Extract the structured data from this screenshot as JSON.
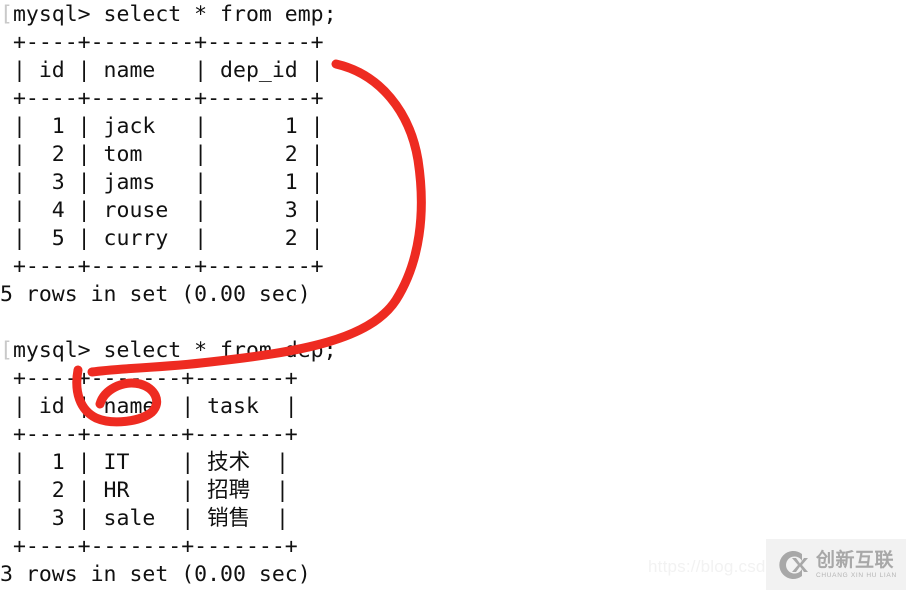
{
  "terminal": {
    "prompt_bracket": "[",
    "lines": [
      {
        "type": "command",
        "text": "mysql> select * from emp;",
        "indent": 0,
        "bracket": true
      },
      {
        "type": "separator",
        "text": "+----+--------+--------+",
        "indent": 1,
        "bracket": false
      },
      {
        "type": "header",
        "text": "| id | name   | dep_id |",
        "indent": 1,
        "bracket": false
      },
      {
        "type": "separator",
        "text": "+----+--------+--------+",
        "indent": 1,
        "bracket": false
      },
      {
        "type": "row",
        "text": "|  1 | jack   |      1 |",
        "indent": 1,
        "bracket": false
      },
      {
        "type": "row",
        "text": "|  2 | tom    |      2 |",
        "indent": 1,
        "bracket": false
      },
      {
        "type": "row",
        "text": "|  3 | jams   |      1 |",
        "indent": 1,
        "bracket": false
      },
      {
        "type": "row",
        "text": "|  4 | rouse  |      3 |",
        "indent": 1,
        "bracket": false
      },
      {
        "type": "row",
        "text": "|  5 | curry  |      2 |",
        "indent": 1,
        "bracket": false
      },
      {
        "type": "separator",
        "text": "+----+--------+--------+",
        "indent": 1,
        "bracket": false
      },
      {
        "type": "status",
        "text": "5 rows in set (0.00 sec)",
        "indent": 0,
        "bracket": false
      },
      {
        "type": "blank",
        "text": "",
        "indent": 0,
        "bracket": false
      },
      {
        "type": "command",
        "text": "mysql> select * from dep;",
        "indent": 0,
        "bracket": true
      },
      {
        "type": "separator",
        "text": "+----+-------+-------+",
        "indent": 1,
        "bracket": false
      },
      {
        "type": "header",
        "text": "| id | name  | task  |",
        "indent": 1,
        "bracket": false
      },
      {
        "type": "separator",
        "text": "+----+-------+-------+",
        "indent": 1,
        "bracket": false
      },
      {
        "type": "row",
        "text": "|  1 | IT    | 技术  |",
        "indent": 1,
        "bracket": false
      },
      {
        "type": "row",
        "text": "|  2 | HR    | 招聘  |",
        "indent": 1,
        "bracket": false
      },
      {
        "type": "row",
        "text": "|  3 | sale  | 销售  |",
        "indent": 1,
        "bracket": false
      },
      {
        "type": "separator",
        "text": "+----+-------+-------+",
        "indent": 1,
        "bracket": false
      },
      {
        "type": "status",
        "text": "3 rows in set (0.00 sec)",
        "indent": 0,
        "bracket": false
      }
    ]
  },
  "queries": [
    {
      "sql": "select * from emp;",
      "table": "emp",
      "columns": [
        "id",
        "name",
        "dep_id"
      ],
      "rows": [
        [
          "1",
          "jack",
          "1"
        ],
        [
          "2",
          "tom",
          "2"
        ],
        [
          "3",
          "jams",
          "1"
        ],
        [
          "4",
          "rouse",
          "3"
        ],
        [
          "5",
          "curry",
          "2"
        ]
      ],
      "result_status": "5 rows in set (0.00 sec)"
    },
    {
      "sql": "select * from dep;",
      "table": "dep",
      "columns": [
        "id",
        "name",
        "task"
      ],
      "rows": [
        [
          "1",
          "IT",
          "技术"
        ],
        [
          "2",
          "HR",
          "招聘"
        ],
        [
          "3",
          "sale",
          "销售"
        ]
      ],
      "result_status": "3 rows in set (0.00 sec)"
    }
  ],
  "annotation": {
    "color": "#ee2b21",
    "stroke_width": 9,
    "description": "red hand-drawn curve linking emp.dep_id column to dep.id column"
  },
  "watermark": {
    "url": "https://blog.csdn",
    "brand_cn": "创新互联",
    "brand_pinyin": "CHUANG XIN HU LIAN",
    "logo_letters": "CX",
    "bg_color": "#f2f2f2",
    "text_color": "#a8a8a8"
  }
}
